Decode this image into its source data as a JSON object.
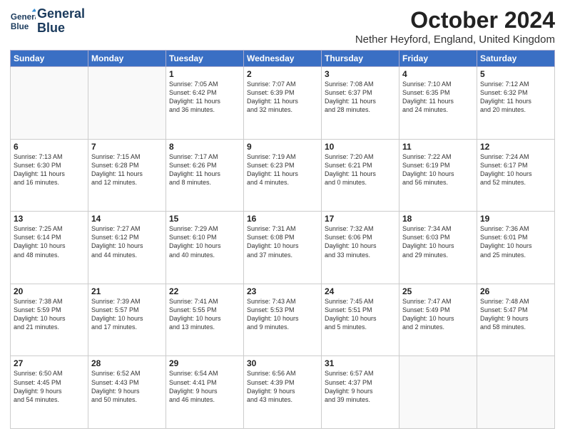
{
  "header": {
    "logo_line1": "General",
    "logo_line2": "Blue",
    "month_title": "October 2024",
    "location": "Nether Heyford, England, United Kingdom"
  },
  "weekdays": [
    "Sunday",
    "Monday",
    "Tuesday",
    "Wednesday",
    "Thursday",
    "Friday",
    "Saturday"
  ],
  "weeks": [
    [
      {
        "day": "",
        "info": ""
      },
      {
        "day": "",
        "info": ""
      },
      {
        "day": "1",
        "info": "Sunrise: 7:05 AM\nSunset: 6:42 PM\nDaylight: 11 hours\nand 36 minutes."
      },
      {
        "day": "2",
        "info": "Sunrise: 7:07 AM\nSunset: 6:39 PM\nDaylight: 11 hours\nand 32 minutes."
      },
      {
        "day": "3",
        "info": "Sunrise: 7:08 AM\nSunset: 6:37 PM\nDaylight: 11 hours\nand 28 minutes."
      },
      {
        "day": "4",
        "info": "Sunrise: 7:10 AM\nSunset: 6:35 PM\nDaylight: 11 hours\nand 24 minutes."
      },
      {
        "day": "5",
        "info": "Sunrise: 7:12 AM\nSunset: 6:32 PM\nDaylight: 11 hours\nand 20 minutes."
      }
    ],
    [
      {
        "day": "6",
        "info": "Sunrise: 7:13 AM\nSunset: 6:30 PM\nDaylight: 11 hours\nand 16 minutes."
      },
      {
        "day": "7",
        "info": "Sunrise: 7:15 AM\nSunset: 6:28 PM\nDaylight: 11 hours\nand 12 minutes."
      },
      {
        "day": "8",
        "info": "Sunrise: 7:17 AM\nSunset: 6:26 PM\nDaylight: 11 hours\nand 8 minutes."
      },
      {
        "day": "9",
        "info": "Sunrise: 7:19 AM\nSunset: 6:23 PM\nDaylight: 11 hours\nand 4 minutes."
      },
      {
        "day": "10",
        "info": "Sunrise: 7:20 AM\nSunset: 6:21 PM\nDaylight: 11 hours\nand 0 minutes."
      },
      {
        "day": "11",
        "info": "Sunrise: 7:22 AM\nSunset: 6:19 PM\nDaylight: 10 hours\nand 56 minutes."
      },
      {
        "day": "12",
        "info": "Sunrise: 7:24 AM\nSunset: 6:17 PM\nDaylight: 10 hours\nand 52 minutes."
      }
    ],
    [
      {
        "day": "13",
        "info": "Sunrise: 7:25 AM\nSunset: 6:14 PM\nDaylight: 10 hours\nand 48 minutes."
      },
      {
        "day": "14",
        "info": "Sunrise: 7:27 AM\nSunset: 6:12 PM\nDaylight: 10 hours\nand 44 minutes."
      },
      {
        "day": "15",
        "info": "Sunrise: 7:29 AM\nSunset: 6:10 PM\nDaylight: 10 hours\nand 40 minutes."
      },
      {
        "day": "16",
        "info": "Sunrise: 7:31 AM\nSunset: 6:08 PM\nDaylight: 10 hours\nand 37 minutes."
      },
      {
        "day": "17",
        "info": "Sunrise: 7:32 AM\nSunset: 6:06 PM\nDaylight: 10 hours\nand 33 minutes."
      },
      {
        "day": "18",
        "info": "Sunrise: 7:34 AM\nSunset: 6:03 PM\nDaylight: 10 hours\nand 29 minutes."
      },
      {
        "day": "19",
        "info": "Sunrise: 7:36 AM\nSunset: 6:01 PM\nDaylight: 10 hours\nand 25 minutes."
      }
    ],
    [
      {
        "day": "20",
        "info": "Sunrise: 7:38 AM\nSunset: 5:59 PM\nDaylight: 10 hours\nand 21 minutes."
      },
      {
        "day": "21",
        "info": "Sunrise: 7:39 AM\nSunset: 5:57 PM\nDaylight: 10 hours\nand 17 minutes."
      },
      {
        "day": "22",
        "info": "Sunrise: 7:41 AM\nSunset: 5:55 PM\nDaylight: 10 hours\nand 13 minutes."
      },
      {
        "day": "23",
        "info": "Sunrise: 7:43 AM\nSunset: 5:53 PM\nDaylight: 10 hours\nand 9 minutes."
      },
      {
        "day": "24",
        "info": "Sunrise: 7:45 AM\nSunset: 5:51 PM\nDaylight: 10 hours\nand 5 minutes."
      },
      {
        "day": "25",
        "info": "Sunrise: 7:47 AM\nSunset: 5:49 PM\nDaylight: 10 hours\nand 2 minutes."
      },
      {
        "day": "26",
        "info": "Sunrise: 7:48 AM\nSunset: 5:47 PM\nDaylight: 9 hours\nand 58 minutes."
      }
    ],
    [
      {
        "day": "27",
        "info": "Sunrise: 6:50 AM\nSunset: 4:45 PM\nDaylight: 9 hours\nand 54 minutes."
      },
      {
        "day": "28",
        "info": "Sunrise: 6:52 AM\nSunset: 4:43 PM\nDaylight: 9 hours\nand 50 minutes."
      },
      {
        "day": "29",
        "info": "Sunrise: 6:54 AM\nSunset: 4:41 PM\nDaylight: 9 hours\nand 46 minutes."
      },
      {
        "day": "30",
        "info": "Sunrise: 6:56 AM\nSunset: 4:39 PM\nDaylight: 9 hours\nand 43 minutes."
      },
      {
        "day": "31",
        "info": "Sunrise: 6:57 AM\nSunset: 4:37 PM\nDaylight: 9 hours\nand 39 minutes."
      },
      {
        "day": "",
        "info": ""
      },
      {
        "day": "",
        "info": ""
      }
    ]
  ]
}
